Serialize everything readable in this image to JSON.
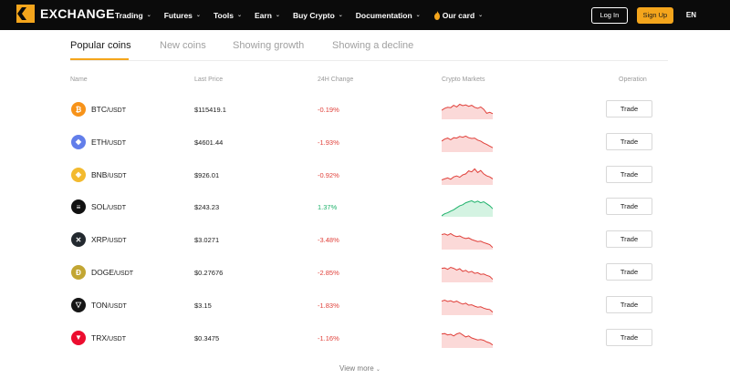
{
  "brand": {
    "name": "EXCHANGE",
    "accent": "#f4a51c"
  },
  "nav": {
    "items": [
      {
        "label": "Trading",
        "name": "nav-trading"
      },
      {
        "label": "Futures",
        "name": "nav-futures"
      },
      {
        "label": "Tools",
        "name": "nav-tools"
      },
      {
        "label": "Earn",
        "name": "nav-earn"
      },
      {
        "label": "Buy Crypto",
        "name": "nav-buy-crypto"
      },
      {
        "label": "Documentation",
        "name": "nav-documentation"
      },
      {
        "label": "Our card",
        "name": "nav-our-card",
        "icon": "flame-icon"
      }
    ],
    "login": "Log In",
    "signup": "Sign Up",
    "lang": "EN"
  },
  "tabs": [
    {
      "label": "Popular coins",
      "active": true
    },
    {
      "label": "New coins",
      "active": false
    },
    {
      "label": "Showing growth",
      "active": false
    },
    {
      "label": "Showing a decline",
      "active": false
    }
  ],
  "columns": {
    "name": "Name",
    "last_price": "Last Price",
    "change": "24H Change",
    "markets": "Crypto Markets",
    "operation": "Operation"
  },
  "rows": [
    {
      "base": "BTC",
      "quote": "/USDT",
      "price": "$115419.1",
      "change": "-0.19%",
      "trend": "down",
      "icon": "btc-icon",
      "color": "#f7931a",
      "glyph": "₿",
      "spark": [
        0.55,
        0.45,
        0.4,
        0.42,
        0.3,
        0.38,
        0.25,
        0.32,
        0.28,
        0.35,
        0.3,
        0.4,
        0.45,
        0.38,
        0.5,
        0.7,
        0.65,
        0.72
      ]
    },
    {
      "base": "ETH",
      "quote": "/USDT",
      "price": "$4601.44",
      "change": "-1.93%",
      "trend": "down",
      "icon": "eth-icon",
      "color": "#627eea",
      "glyph": "◆",
      "spark": [
        0.45,
        0.35,
        0.3,
        0.38,
        0.28,
        0.3,
        0.22,
        0.26,
        0.2,
        0.28,
        0.32,
        0.3,
        0.4,
        0.45,
        0.55,
        0.62,
        0.7,
        0.78
      ]
    },
    {
      "base": "BNB",
      "quote": "/USDT",
      "price": "$926.01",
      "change": "-0.92%",
      "trend": "down",
      "icon": "bnb-icon",
      "color": "#f3ba2f",
      "glyph": "◈",
      "spark": [
        0.75,
        0.7,
        0.65,
        0.72,
        0.6,
        0.55,
        0.62,
        0.5,
        0.45,
        0.3,
        0.35,
        0.2,
        0.38,
        0.28,
        0.45,
        0.55,
        0.6,
        0.7
      ]
    },
    {
      "base": "SOL",
      "quote": "/USDT",
      "price": "$243.23",
      "change": "1.37%",
      "trend": "up",
      "icon": "sol-icon",
      "color": "#111111",
      "glyph": "≡",
      "spark": [
        0.95,
        0.85,
        0.8,
        0.72,
        0.65,
        0.55,
        0.45,
        0.4,
        0.3,
        0.25,
        0.2,
        0.28,
        0.22,
        0.3,
        0.25,
        0.35,
        0.45,
        0.6
      ]
    },
    {
      "base": "XRP",
      "quote": "/USDT",
      "price": "$3.0271",
      "change": "-3.48%",
      "trend": "down",
      "icon": "xrp-icon",
      "color": "#23292f",
      "glyph": "✕",
      "spark": [
        0.25,
        0.22,
        0.28,
        0.2,
        0.3,
        0.35,
        0.32,
        0.4,
        0.45,
        0.42,
        0.5,
        0.55,
        0.6,
        0.58,
        0.65,
        0.7,
        0.75,
        0.9
      ]
    },
    {
      "base": "DOGE",
      "quote": "/USDT",
      "price": "$0.27676",
      "change": "-2.85%",
      "trend": "down",
      "icon": "doge-icon",
      "color": "#c2a633",
      "glyph": "Ð",
      "spark": [
        0.3,
        0.28,
        0.35,
        0.25,
        0.3,
        0.38,
        0.32,
        0.45,
        0.4,
        0.5,
        0.45,
        0.55,
        0.52,
        0.6,
        0.58,
        0.65,
        0.7,
        0.85
      ]
    },
    {
      "base": "TON",
      "quote": "/USDT",
      "price": "$3.15",
      "change": "-1.83%",
      "trend": "down",
      "icon": "ton-icon",
      "color": "#161616",
      "glyph": "▽",
      "spark": [
        0.3,
        0.25,
        0.32,
        0.28,
        0.35,
        0.3,
        0.38,
        0.45,
        0.4,
        0.5,
        0.48,
        0.55,
        0.6,
        0.58,
        0.65,
        0.7,
        0.72,
        0.85
      ]
    },
    {
      "base": "TRX",
      "quote": "/USDT",
      "price": "$0.3475",
      "change": "-1.16%",
      "trend": "down",
      "icon": "trx-icon",
      "color": "#ec0d2f",
      "glyph": "▼",
      "spark": [
        0.3,
        0.28,
        0.35,
        0.32,
        0.4,
        0.3,
        0.25,
        0.35,
        0.45,
        0.4,
        0.5,
        0.55,
        0.6,
        0.58,
        0.62,
        0.7,
        0.75,
        0.85
      ]
    }
  ],
  "trade_label": "Trade",
  "view_more": "View more"
}
